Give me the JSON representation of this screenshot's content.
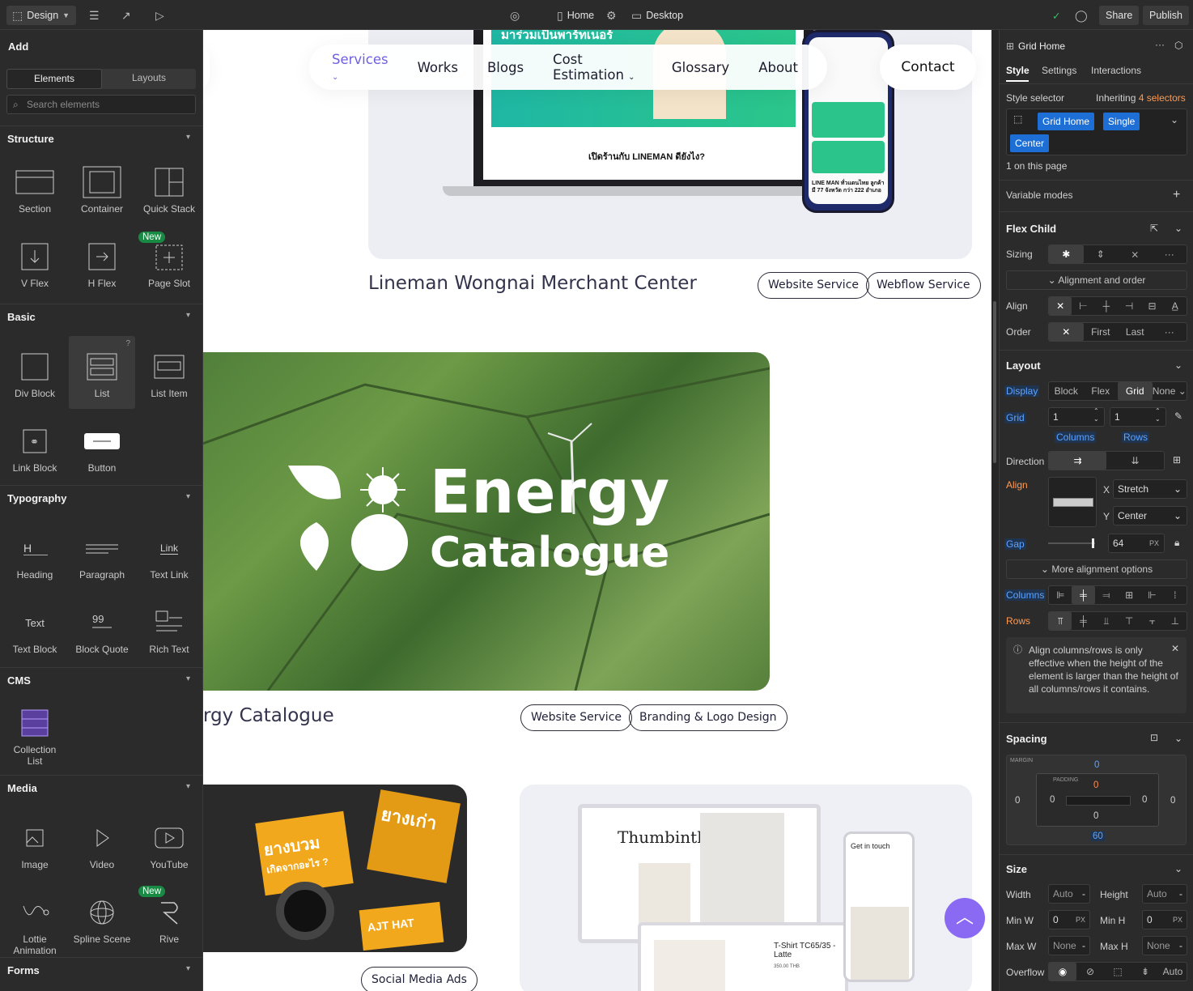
{
  "topbar": {
    "mode_label": "Design",
    "page_label": "Home",
    "breakpoint_label": "Desktop",
    "share_label": "Share",
    "publish_label": "Publish"
  },
  "left_panel": {
    "title": "Add",
    "tabs": [
      "Elements",
      "Layouts"
    ],
    "search_placeholder": "Search elements",
    "badge_new": "New",
    "sections": [
      {
        "title": "Structure",
        "items": [
          "Section",
          "Container",
          "Quick Stack",
          "V Flex",
          "H Flex",
          "Page Slot"
        ]
      },
      {
        "title": "Basic",
        "items": [
          "Div Block",
          "List",
          "List Item",
          "Link Block",
          "Button"
        ]
      },
      {
        "title": "Typography",
        "items": [
          "Heading",
          "Paragraph",
          "Text Link",
          "Text Block",
          "Block Quote",
          "Rich Text"
        ]
      },
      {
        "title": "CMS",
        "items": [
          "Collection List"
        ]
      },
      {
        "title": "Media",
        "items": [
          "Image",
          "Video",
          "YouTube",
          "Lottie Animation",
          "Spline Scene",
          "Rive"
        ]
      },
      {
        "title": "Forms",
        "items": []
      }
    ],
    "heading_icon_text": "H",
    "textlink_icon_text": "Link",
    "textblock_icon_text": "Text"
  },
  "canvas": {
    "nav": {
      "items": [
        "Services",
        "Works",
        "Blogs",
        "Cost Estimation",
        "Glossary",
        "About"
      ],
      "contact": "Contact"
    },
    "projects": [
      {
        "title": "Lineman Wongnai Merchant Center",
        "tags": [
          "Website Service",
          "Webflow Service"
        ]
      },
      {
        "title": "rgy Catalogue",
        "tags": [
          "Website Service",
          "Branding & Logo Design"
        ]
      },
      {
        "title": "",
        "tags": [
          "Social Media Ads"
        ]
      }
    ],
    "laptop_text": "เปิดร้านกับ LINEMAN ดียังไง?",
    "banner_text": "มาร่วมเป็นพาร์ทเนอร์",
    "phone_caption": "LINE MAN ทั่วแดนไทย ลูกค้ามี 77 จังหวัด กว่า 222 อำเภอ",
    "energy_title": "Energy",
    "energy_sub": "Catalogue",
    "tire_text_1": "ยางบวม",
    "tire_text_2": "เกิดจากอะไร ?",
    "tire_text_3": "ยางเก่า",
    "tire_text_4": "AJT HAT",
    "thumb_title": "Thumbinthai",
    "thumb_get": "Get in touch",
    "thumb_tshirt": "T-Shirt TC65/35 - Latte",
    "thumb_price": "350.00 THB"
  },
  "right_panel": {
    "element_name": "Grid Home",
    "tabs": [
      "Style",
      "Settings",
      "Interactions"
    ],
    "style_selector_label": "Style selector",
    "inheriting_text": "Inheriting",
    "inheriting_count": "4 selectors",
    "chips": [
      "Grid Home",
      "Single",
      "Center"
    ],
    "on_page": "1 on this page",
    "variable_modes": "Variable modes",
    "flex_child": "Flex Child",
    "sizing_label": "Sizing",
    "alignment_order": "Alignment and order",
    "align_label": "Align",
    "order_label": "Order",
    "order_options": [
      "First",
      "Last"
    ],
    "layout_title": "Layout",
    "display_label": "Display",
    "display_options": [
      "Block",
      "Flex",
      "Grid",
      "None"
    ],
    "grid_label": "Grid",
    "grid_columns": "1",
    "grid_rows": "1",
    "columns_label": "Columns",
    "rows_label": "Rows",
    "direction_label": "Direction",
    "x_label": "X",
    "y_label": "Y",
    "align_x": "Stretch",
    "align_y": "Center",
    "gap_label": "Gap",
    "gap_value": "64",
    "gap_unit": "PX",
    "more_align": "More alignment options",
    "info_text": "Align columns/rows is only effective when the height of the element is larger than the height of all columns/rows it contains.",
    "spacing_title": "Spacing",
    "margin_label": "MARGIN",
    "padding_label": "PADDING",
    "margin_top": "0",
    "margin_left": "0",
    "margin_right": "0",
    "margin_bottom": "60",
    "padding_top": "0",
    "padding_left": "0",
    "padding_right": "0",
    "padding_bottom": "0",
    "size_title": "Size",
    "width_label": "Width",
    "height_label": "Height",
    "auto": "Auto",
    "minw_label": "Min W",
    "minh_label": "Min H",
    "maxw_label": "Max W",
    "maxh_label": "Max H",
    "min_value": "0",
    "none_value": "None",
    "px": "PX",
    "overflow_label": "Overflow",
    "overflow_auto": "Auto"
  },
  "colors": {
    "accent": "#1d6fd6",
    "nav_active": "#6e5fe0",
    "fab": "#8a6af2",
    "new_badge": "#198a43"
  }
}
